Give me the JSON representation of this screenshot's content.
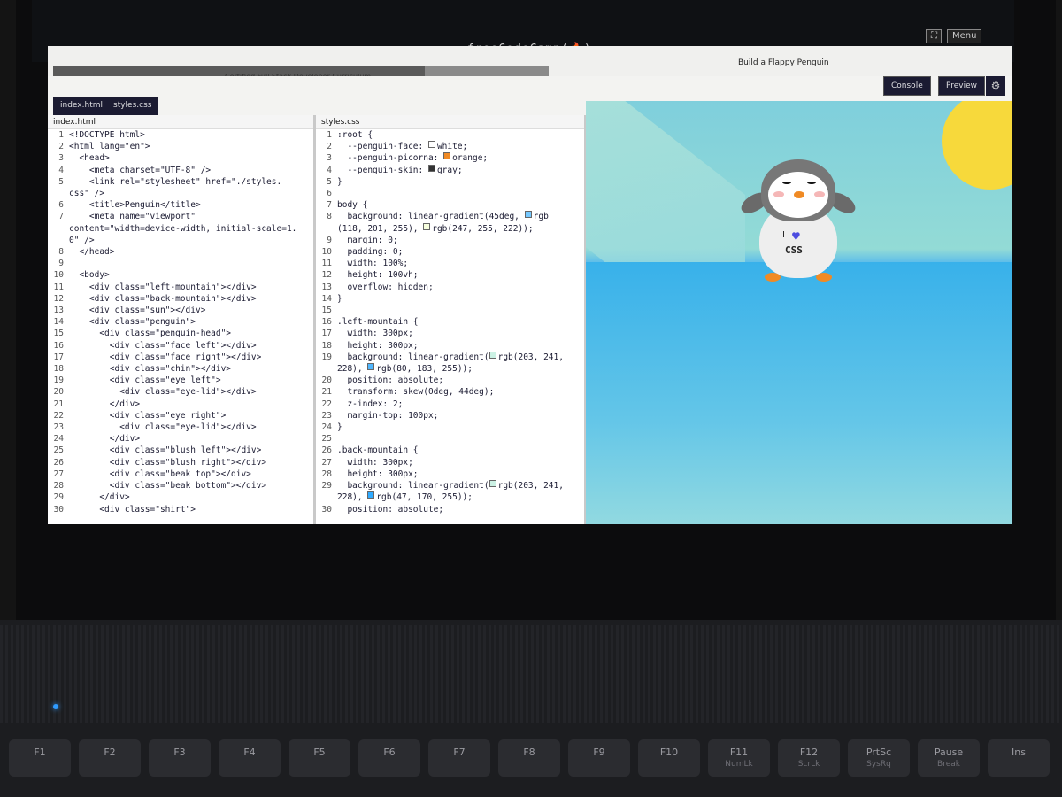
{
  "os": {
    "logo": "freeCodeCamp(🔥)",
    "menu_label": "Menu"
  },
  "header": {
    "curriculum_title": "Certified Full Stack Developer Curriculum",
    "lesson_title": "Build a Flappy Penguin",
    "progress": 0.75
  },
  "tabs": [
    {
      "label": "index.html",
      "active": false
    },
    {
      "label": "styles.css",
      "active": true
    }
  ],
  "actions": {
    "console_label": "Console",
    "preview_label": "Preview"
  },
  "html_editor": {
    "filename": "index.html",
    "lines": [
      {
        "n": "1",
        "text": "<!DOCTYPE html>"
      },
      {
        "n": "2",
        "text": "<html lang=\"en\">"
      },
      {
        "n": "3",
        "text": "  <head>"
      },
      {
        "n": "4",
        "text": "    <meta charset=\"UTF-8\" />"
      },
      {
        "n": "5",
        "text": "    <link rel=\"stylesheet\" href=\"./styles."
      },
      {
        "n": "",
        "text": "css\" />"
      },
      {
        "n": "6",
        "text": "    <title>Penguin</title>"
      },
      {
        "n": "7",
        "text": "    <meta name=\"viewport\""
      },
      {
        "n": "",
        "text": "content=\"width=device-width, initial-scale=1."
      },
      {
        "n": "",
        "text": "0\" />"
      },
      {
        "n": "8",
        "text": "  </head>"
      },
      {
        "n": "9",
        "text": ""
      },
      {
        "n": "10",
        "text": "  <body>"
      },
      {
        "n": "11",
        "text": "    <div class=\"left-mountain\"></div>"
      },
      {
        "n": "12",
        "text": "    <div class=\"back-mountain\"></div>"
      },
      {
        "n": "13",
        "text": "    <div class=\"sun\"></div>"
      },
      {
        "n": "14",
        "text": "    <div class=\"penguin\">"
      },
      {
        "n": "15",
        "text": "      <div class=\"penguin-head\">"
      },
      {
        "n": "16",
        "text": "        <div class=\"face left\"></div>"
      },
      {
        "n": "17",
        "text": "        <div class=\"face right\"></div>"
      },
      {
        "n": "18",
        "text": "        <div class=\"chin\"></div>"
      },
      {
        "n": "19",
        "text": "        <div class=\"eye left\">"
      },
      {
        "n": "20",
        "text": "          <div class=\"eye-lid\"></div>"
      },
      {
        "n": "21",
        "text": "        </div>"
      },
      {
        "n": "22",
        "text": "        <div class=\"eye right\">"
      },
      {
        "n": "23",
        "text": "          <div class=\"eye-lid\"></div>"
      },
      {
        "n": "24",
        "text": "        </div>"
      },
      {
        "n": "25",
        "text": "        <div class=\"blush left\"></div>"
      },
      {
        "n": "26",
        "text": "        <div class=\"blush right\"></div>"
      },
      {
        "n": "27",
        "text": "        <div class=\"beak top\"></div>"
      },
      {
        "n": "28",
        "text": "        <div class=\"beak bottom\"></div>"
      },
      {
        "n": "29",
        "text": "      </div>"
      },
      {
        "n": "30",
        "text": "      <div class=\"shirt\">"
      }
    ]
  },
  "css_editor": {
    "filename": "styles.css",
    "lines": [
      {
        "n": "1",
        "text": ":root {"
      },
      {
        "n": "2",
        "text": "  --penguin-face: ",
        "swatch": "#ffffff",
        "tail": "white;"
      },
      {
        "n": "3",
        "text": "  --penguin-picorna: ",
        "swatch": "#f08a24",
        "tail": "orange;"
      },
      {
        "n": "4",
        "text": "  --penguin-skin: ",
        "swatch": "#333333",
        "tail": "gray;"
      },
      {
        "n": "5",
        "text": "}"
      },
      {
        "n": "6",
        "text": ""
      },
      {
        "n": "7",
        "text": "body {"
      },
      {
        "n": "8",
        "text": "  background: linear-gradient(45deg, ",
        "swatch": "#76c9ff",
        "tail": "rgb"
      },
      {
        "n": "",
        "text": "(118, 201, 255), ",
        "swatch": "#f7ffde",
        "tail": "rgb(247, 255, 222));"
      },
      {
        "n": "9",
        "text": "  margin: 0;"
      },
      {
        "n": "10",
        "text": "  padding: 0;"
      },
      {
        "n": "11",
        "text": "  width: 100%;"
      },
      {
        "n": "12",
        "text": "  height: 100vh;"
      },
      {
        "n": "13",
        "text": "  overflow: hidden;"
      },
      {
        "n": "14",
        "text": "}"
      },
      {
        "n": "15",
        "text": ""
      },
      {
        "n": "16",
        "text": ".left-mountain {"
      },
      {
        "n": "17",
        "text": "  width: 300px;"
      },
      {
        "n": "18",
        "text": "  height: 300px;"
      },
      {
        "n": "19",
        "text": "  background: linear-gradient(",
        "swatch": "#cbf1e4",
        "tail": "rgb(203, 241,"
      },
      {
        "n": "",
        "text": "228), ",
        "swatch": "#50b7ff",
        "tail": "rgb(80, 183, 255));"
      },
      {
        "n": "20",
        "text": "  position: absolute;"
      },
      {
        "n": "21",
        "text": "  transform: skew(0deg, 44deg);"
      },
      {
        "n": "22",
        "text": "  z-index: 2;"
      },
      {
        "n": "23",
        "text": "  margin-top: 100px;"
      },
      {
        "n": "24",
        "text": "}"
      },
      {
        "n": "25",
        "text": ""
      },
      {
        "n": "26",
        "text": ".back-mountain {"
      },
      {
        "n": "27",
        "text": "  width: 300px;"
      },
      {
        "n": "28",
        "text": "  height: 300px;"
      },
      {
        "n": "29",
        "text": "  background: linear-gradient(",
        "swatch": "#cbf1e4",
        "tail": "rgb(203, 241,"
      },
      {
        "n": "",
        "text": "228), ",
        "swatch": "#2faaff",
        "tail": "rgb(47, 170, 255));"
      },
      {
        "n": "30",
        "text": "  position: absolute;"
      }
    ]
  },
  "preview": {
    "penguin_text_i": "I",
    "penguin_text_css": "CSS"
  },
  "fkeys": [
    {
      "label": "F1",
      "sub": ""
    },
    {
      "label": "F2",
      "sub": ""
    },
    {
      "label": "F3",
      "sub": ""
    },
    {
      "label": "F4",
      "sub": ""
    },
    {
      "label": "F5",
      "sub": ""
    },
    {
      "label": "F6",
      "sub": ""
    },
    {
      "label": "F7",
      "sub": ""
    },
    {
      "label": "F8",
      "sub": ""
    },
    {
      "label": "F9",
      "sub": ""
    },
    {
      "label": "F10",
      "sub": ""
    },
    {
      "label": "F11",
      "sub": "NumLk"
    },
    {
      "label": "F12",
      "sub": "ScrLk"
    },
    {
      "label": "PrtSc",
      "sub": "SysRq"
    },
    {
      "label": "Pause",
      "sub": "Break"
    },
    {
      "label": "Ins",
      "sub": ""
    }
  ],
  "colors": {
    "fcc_dark": "#1b1b32",
    "sun": "#f7d93b",
    "beak": "#f08a24"
  }
}
